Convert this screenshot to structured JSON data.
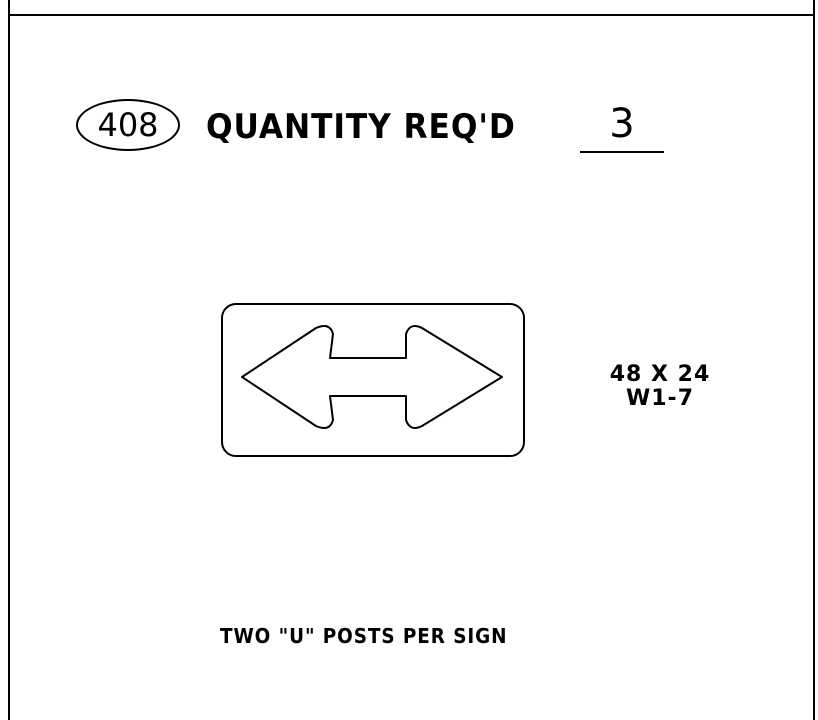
{
  "item_number": "408",
  "quantity": {
    "label": "QUANTITY REQ'D",
    "value": "3"
  },
  "sign": {
    "symbol": "double-headed-arrow-icon",
    "size": "48 X 24",
    "code": "W1-7"
  },
  "note": "TWO \"U\" POSTS PER SIGN"
}
